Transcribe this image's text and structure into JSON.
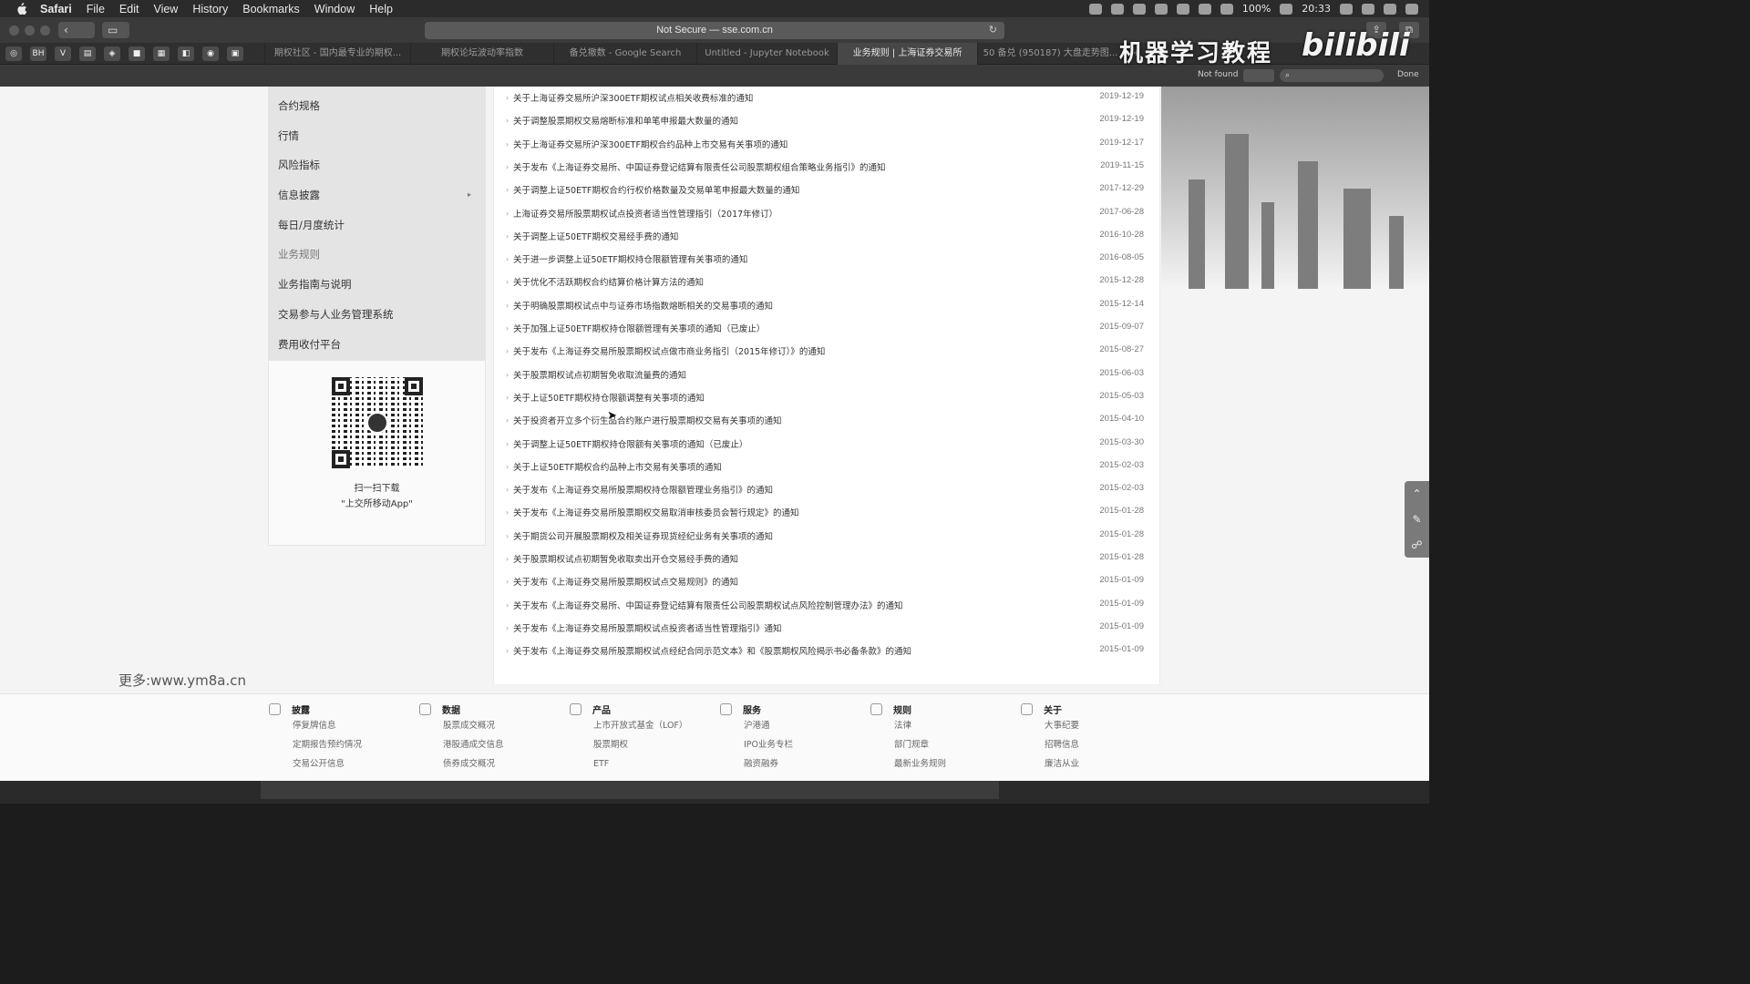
{
  "menubar": {
    "app": "Safari",
    "items": [
      "File",
      "Edit",
      "View",
      "History",
      "Bookmarks",
      "Window",
      "Help"
    ],
    "battery": "100%",
    "clock": "20:33"
  },
  "toolbar": {
    "url": "Not Secure — sse.com.cn"
  },
  "favorites": [
    "BH",
    "V"
  ],
  "tabs": [
    {
      "label": "期权社区 - 国内最专业的期权..."
    },
    {
      "label": "期权论坛波动率指数"
    },
    {
      "label": "备兑撤数 - Google Search"
    },
    {
      "label": "Untitled - Jupyter Notebook"
    },
    {
      "label": "业务规则 | 上海证券交易所"
    },
    {
      "label": "50 备兑 (950187) 大盘走势图..."
    }
  ],
  "findbar": {
    "not_found": "Not found",
    "done": "Done"
  },
  "brand": {
    "title": "机器学习教程",
    "logo": "bilibili"
  },
  "sidebar": {
    "items": [
      {
        "label": "合约规格"
      },
      {
        "label": "行情"
      },
      {
        "label": "风险指标"
      },
      {
        "label": "信息披露"
      },
      {
        "label": "每日/月度统计"
      },
      {
        "label": "业务规则"
      },
      {
        "label": "业务指南与说明"
      },
      {
        "label": "交易参与人业务管理系统"
      },
      {
        "label": "费用收付平台"
      }
    ],
    "qr_caption_1": "扫一扫下载",
    "qr_caption_2": "\"上交所移动App\""
  },
  "notices": [
    {
      "title": "关于上海证券交易所沪深300ETF期权试点相关收费标准的通知",
      "date": "2019-12-19"
    },
    {
      "title": "关于调整股票期权交易熔断标准和单笔申报最大数量的通知",
      "date": "2019-12-19"
    },
    {
      "title": "关于上海证券交易所沪深300ETF期权合约品种上市交易有关事项的通知",
      "date": "2019-12-17"
    },
    {
      "title": "关于发布《上海证券交易所、中国证券登记结算有限责任公司股票期权组合策略业务指引》的通知",
      "date": "2019-11-15"
    },
    {
      "title": "关于调整上证50ETF期权合约行权价格数量及交易单笔申报最大数量的通知",
      "date": "2017-12-29"
    },
    {
      "title": "上海证券交易所股票期权试点投资者适当性管理指引（2017年修订）",
      "date": "2017-06-28"
    },
    {
      "title": "关于调整上证50ETF期权交易经手费的通知",
      "date": "2016-10-28"
    },
    {
      "title": "关于进一步调整上证50ETF期权持仓限额管理有关事项的通知",
      "date": "2016-08-05"
    },
    {
      "title": "关于优化不活跃期权合约结算价格计算方法的通知",
      "date": "2015-12-28"
    },
    {
      "title": "关于明确股票期权试点中与证券市场指数熔断相关的交易事项的通知",
      "date": "2015-12-14"
    },
    {
      "title": "关于加强上证50ETF期权持仓限额管理有关事项的通知（已废止）",
      "date": "2015-09-07"
    },
    {
      "title": "关于发布《上海证券交易所股票期权试点做市商业务指引（2015年修订）》的通知",
      "date": "2015-08-27"
    },
    {
      "title": "关于股票期权试点初期暂免收取流量费的通知",
      "date": "2015-06-03"
    },
    {
      "title": "关于上证50ETF期权持仓限额调整有关事项的通知",
      "date": "2015-05-03"
    },
    {
      "title": "关于投资者开立多个衍生品合约账户进行股票期权交易有关事项的通知",
      "date": "2015-04-10"
    },
    {
      "title": "关于调整上证50ETF期权持仓限额有关事项的通知（已废止）",
      "date": "2015-03-30"
    },
    {
      "title": "关于上证50ETF期权合约品种上市交易有关事项的通知",
      "date": "2015-02-03"
    },
    {
      "title": "关于发布《上海证券交易所股票期权持仓限额管理业务指引》的通知",
      "date": "2015-02-03"
    },
    {
      "title": "关于发布《上海证券交易所股票期权交易取消审核委员会暂行规定》的通知",
      "date": "2015-01-28"
    },
    {
      "title": "关于期货公司开展股票期权及相关证券现货经纪业务有关事项的通知",
      "date": "2015-01-28"
    },
    {
      "title": "关于股票期权试点初期暂免收取卖出开仓交易经手费的通知",
      "date": "2015-01-28"
    },
    {
      "title": "关于发布《上海证券交易所股票期权试点交易规则》的通知",
      "date": "2015-01-09"
    },
    {
      "title": "关于发布《上海证券交易所、中国证券登记结算有限责任公司股票期权试点风险控制管理办法》的通知",
      "date": "2015-01-09"
    },
    {
      "title": "关于发布《上海证券交易所股票期权试点投资者适当性管理指引》通知",
      "date": "2015-01-09"
    },
    {
      "title": "关于发布《上海证券交易所股票期权试点经纪合同示范文本》和《股票期权风险揭示书必备条款》的通知",
      "date": "2015-01-09"
    }
  ],
  "watermark": "更多:www.ym8a.cn",
  "footer": [
    {
      "heading": "披露",
      "links": [
        "停复牌信息",
        "定期报告预约情况",
        "交易公开信息"
      ]
    },
    {
      "heading": "数据",
      "links": [
        "股票成交概况",
        "港股通成交信息",
        "债券成交概况"
      ]
    },
    {
      "heading": "产品",
      "links": [
        "上市开放式基金（LOF）",
        "股票期权",
        "ETF"
      ]
    },
    {
      "heading": "服务",
      "links": [
        "沪港通",
        "IPO业务专栏",
        "融资融券"
      ]
    },
    {
      "heading": "规则",
      "links": [
        "法律",
        "部门规章",
        "最新业务规则"
      ]
    },
    {
      "heading": "关于",
      "links": [
        "大事纪要",
        "招聘信息",
        "廉洁从业"
      ]
    }
  ]
}
